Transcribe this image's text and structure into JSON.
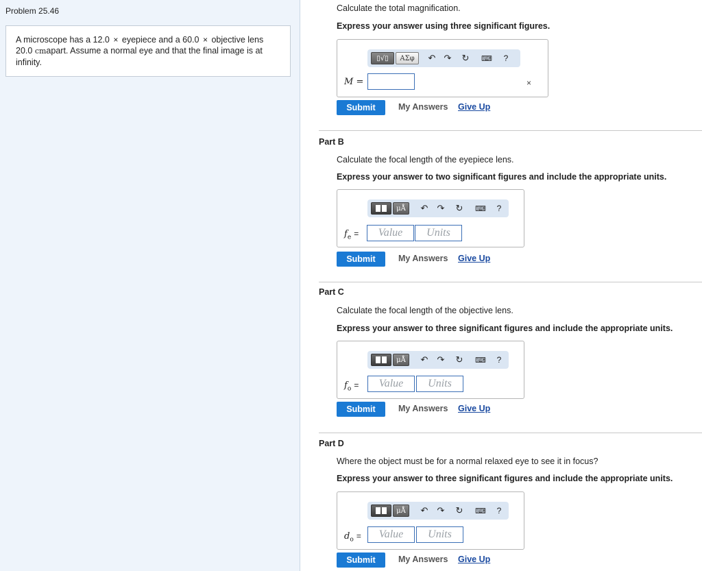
{
  "problem": {
    "title": "Problem 25.46",
    "text_1": "A microscope has a 12.0",
    "times_1": "×",
    "text_2": "eyepiece and a 60.0",
    "times_2": "×",
    "text_3": "objective lens",
    "text_4": "20.0",
    "unit": "cm",
    "text_5": "apart. Assume a normal eye and that the final image is at",
    "text_6": "infinity."
  },
  "toolbar": {
    "templates_label": "▯√▯",
    "symbols_label": "ΑΣφ",
    "units_label": "μÅ",
    "help_label": "?"
  },
  "parts": [
    {
      "label": "",
      "question": "Calculate the total magnification.",
      "instruction": "Express your answer using three significant figures.",
      "variable": "M =",
      "value_placeholder": "",
      "units_placeholder": "",
      "submit": "Submit",
      "my_answers": "My Answers",
      "give_up": "Give Up",
      "clear": "×"
    },
    {
      "label": "Part B",
      "question": "Calculate the focal length of the eyepiece lens.",
      "instruction": "Express your answer to two significant figures and include the appropriate units.",
      "variable": "f",
      "subscript": "e",
      "equals": "=",
      "value_placeholder": "Value",
      "units_placeholder": "Units",
      "submit": "Submit",
      "my_answers": "My Answers",
      "give_up": "Give Up"
    },
    {
      "label": "Part C",
      "question": "Calculate the focal length of the objective lens.",
      "instruction": "Express your answer to three significant figures and include the appropriate units.",
      "variable": "f",
      "subscript": "o",
      "equals": "=",
      "value_placeholder": "Value",
      "units_placeholder": "Units",
      "submit": "Submit",
      "my_answers": "My Answers",
      "give_up": "Give Up"
    },
    {
      "label": "Part D",
      "question": "Where the object must be for a normal relaxed eye to see it in focus?",
      "instruction": "Express your answer to three significant figures and include the appropriate units.",
      "variable": "d",
      "subscript": "o",
      "equals": "=",
      "value_placeholder": "Value",
      "units_placeholder": "Units",
      "submit": "Submit",
      "my_answers": "My Answers",
      "give_up": "Give Up"
    }
  ]
}
